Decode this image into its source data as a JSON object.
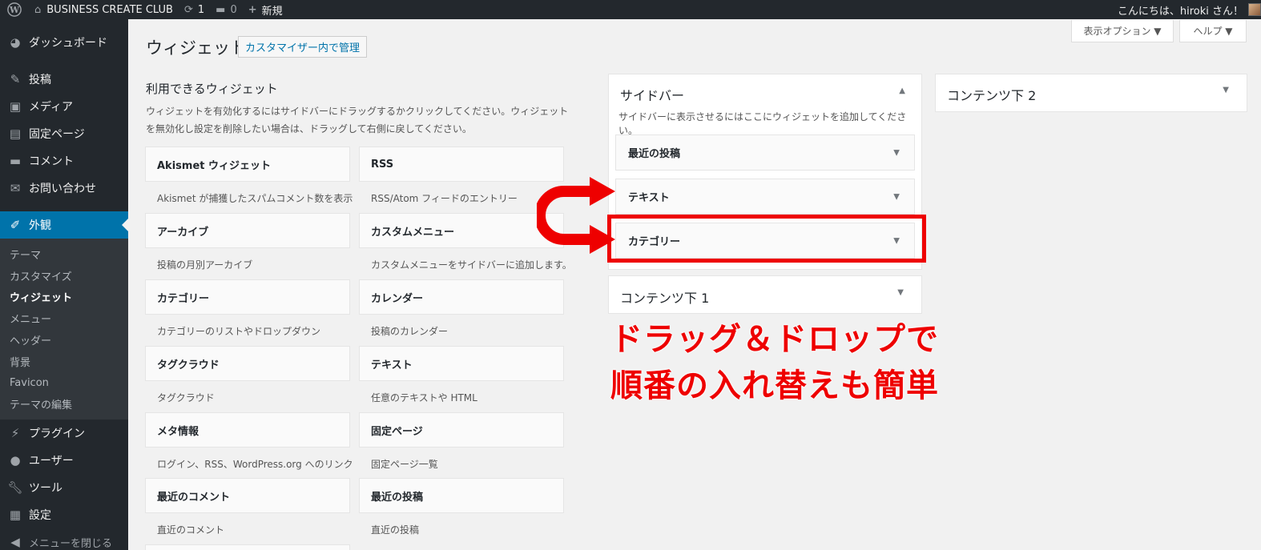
{
  "adminbar": {
    "site_name": "BUSINESS CREATE CLUB",
    "updates_count": "1",
    "comments_count": "0",
    "new_label": "新規",
    "greeting": "こんにちは、hiroki さん！"
  },
  "menu": {
    "dashboard": "ダッシュボード",
    "posts": "投稿",
    "media": "メディア",
    "pages": "固定ページ",
    "comments": "コメント",
    "contact": "お問い合わせ",
    "appearance": "外観",
    "submenu": [
      "テーマ",
      "カスタマイズ",
      "ウィジェット",
      "メニュー",
      "ヘッダー",
      "背景",
      "Favicon",
      "テーマの編集"
    ],
    "plugins": "プラグイン",
    "users": "ユーザー",
    "tools": "ツール",
    "settings": "設定",
    "collapse": "メニューを閉じる"
  },
  "screen_options": "表示オプション ▼",
  "help": "ヘルプ ▼",
  "page_title": "ウィジェット",
  "customizer_button": "カスタマイザー内で管理",
  "available": {
    "title": "利用できるウィジェット",
    "description": "ウィジェットを有効化するにはサイドバーにドラッグするかクリックしてください。ウィジェットを無効化し設定を削除したい場合は、ドラッグして右側に戻してください。",
    "widgets": [
      {
        "name": "Akismet ウィジェット",
        "desc": "Akismet が捕獲したスパムコメント数を表示"
      },
      {
        "name": "RSS",
        "desc": "RSS/Atom フィードのエントリー"
      },
      {
        "name": "アーカイブ",
        "desc": "投稿の月別アーカイブ"
      },
      {
        "name": "カスタムメニュー",
        "desc": "カスタムメニューをサイドバーに追加します。"
      },
      {
        "name": "カテゴリー",
        "desc": "カテゴリーのリストやドロップダウン"
      },
      {
        "name": "カレンダー",
        "desc": "投稿のカレンダー"
      },
      {
        "name": "タグクラウド",
        "desc": "タグクラウド"
      },
      {
        "name": "テキスト",
        "desc": "任意のテキストや HTML"
      },
      {
        "name": "メタ情報",
        "desc": "ログイン、RSS、WordPress.org へのリンク"
      },
      {
        "name": "固定ページ",
        "desc": "固定ページ一覧"
      },
      {
        "name": "最近のコメント",
        "desc": "直近のコメント"
      },
      {
        "name": "最近の投稿",
        "desc": "直近の投稿"
      }
    ]
  },
  "sidebar_area": {
    "title": "サイドバー",
    "description": "サイドバーに表示させるにはここにウィジェットを追加してください。",
    "widgets": [
      "最近の投稿",
      "テキスト",
      "カテゴリー"
    ]
  },
  "content_below_1": "コンテンツ下 1",
  "content_below_2": "コンテンツ下 2",
  "annotation": {
    "line1": "ドラッグ＆ドロップで",
    "line2": "順番の入れ替えも簡単",
    "color": "#ee0000"
  }
}
